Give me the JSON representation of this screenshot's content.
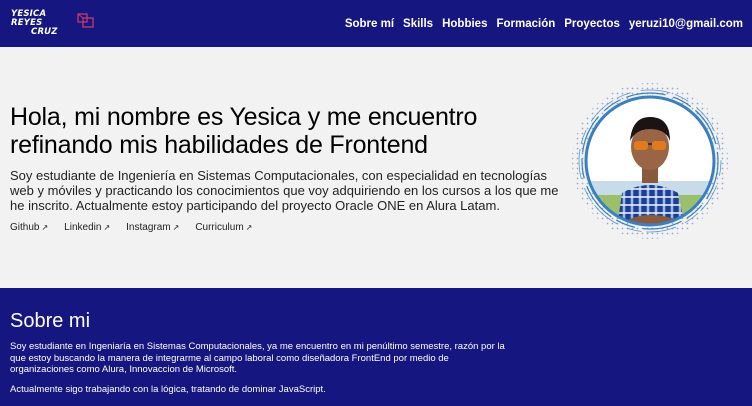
{
  "header": {
    "logo_line1": "YESICA REYES",
    "logo_line2": "CRUZ",
    "nav": [
      "Sobre mí",
      "Skills",
      "Hobbies",
      "Formación",
      "Proyectos",
      "yeruzi10@gmail.com"
    ]
  },
  "hero": {
    "title": "Hola, mi nombre es Yesica y me encuentro refinando mis habilidades de Frontend",
    "description": "Soy estudiante de Ingeniería en Sistemas Computacionales, con especialidad en tecnologías web y móviles y practicando los conocimientos que voy adquiriendo en los cursos a los que me he inscrito. Actualmente estoy participando del proyecto Oracle ONE en Alura Latam.",
    "links": [
      "Github",
      "Linkedin",
      "Instagram",
      "Curriculum"
    ],
    "link_arrow": "↗"
  },
  "about": {
    "title": "Sobre mi",
    "paragraph1": "Soy estudiante en Ingeniaría en Sistemas Computacionales, ya me encuentro en mi penúltimo semestre, razón por la que estoy buscando la manera de integrarme al campo laboral como diseñadora FrontEnd por medio de organizaciones como Alura, Innovaccion de Microsoft.",
    "paragraph2": "Actualmente sigo trabajando con la lógica, tratando de dominar JavaScript."
  },
  "colors": {
    "primary": "#161681",
    "hero_bg": "#f2f2f2",
    "ring": "#3a7fc0"
  }
}
